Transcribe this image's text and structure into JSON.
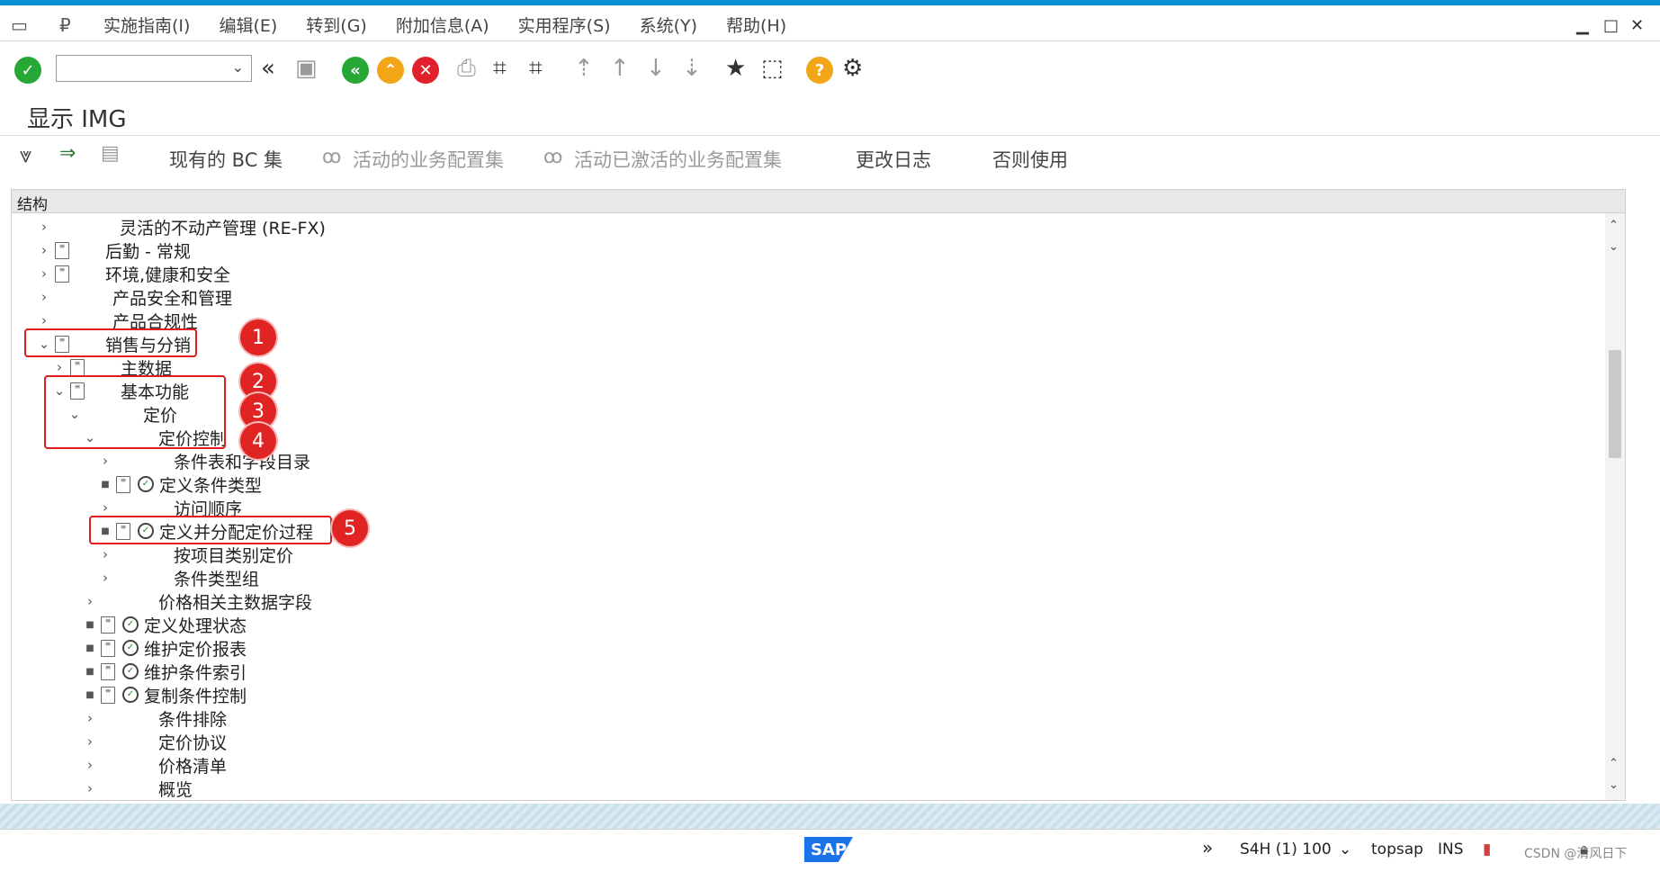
{
  "menu": {
    "items": [
      "实施指南(I)",
      "编辑(E)",
      "转到(G)",
      "附加信息(A)",
      "实用程序(S)",
      "系统(Y)",
      "帮助(H)"
    ]
  },
  "toolbar": {
    "command_value": ""
  },
  "page": {
    "title": "显示 IMG"
  },
  "app_toolbar": {
    "existing_bc": "现有的 BC 集",
    "active_bc": "活动的业务配置集",
    "active_activated_bc": "活动已激活的业务配置集",
    "change_log": "更改日志",
    "else_use": "否则使用"
  },
  "tree": {
    "header": "结构",
    "rows": [
      {
        "label": "灵活的不动产管理 (RE-FX)"
      },
      {
        "label": "后勤 - 常规"
      },
      {
        "label": "环境,健康和安全"
      },
      {
        "label": "产品安全和管理"
      },
      {
        "label": "产品合规性"
      },
      {
        "label": "销售与分销"
      },
      {
        "label": "主数据"
      },
      {
        "label": "基本功能"
      },
      {
        "label": "定价"
      },
      {
        "label": "定价控制"
      },
      {
        "label": "条件表和字段目录"
      },
      {
        "label": "定义条件类型"
      },
      {
        "label": "访问顺序"
      },
      {
        "label": "定义并分配定价过程"
      },
      {
        "label": "按项目类别定价"
      },
      {
        "label": "条件类型组"
      },
      {
        "label": "价格相关主数据字段"
      },
      {
        "label": "定义处理状态"
      },
      {
        "label": "维护定价报表"
      },
      {
        "label": "维护条件索引"
      },
      {
        "label": "复制条件控制"
      },
      {
        "label": "条件排除"
      },
      {
        "label": "定价协议"
      },
      {
        "label": "价格清单"
      },
      {
        "label": "概览"
      }
    ]
  },
  "badges": [
    "1",
    "2",
    "3",
    "4",
    "5"
  ],
  "status": {
    "logo": "SAP",
    "system": "S4H (1) 100",
    "host": "topsap",
    "mode": "INS",
    "watermark": "CSDN @清风日下"
  }
}
